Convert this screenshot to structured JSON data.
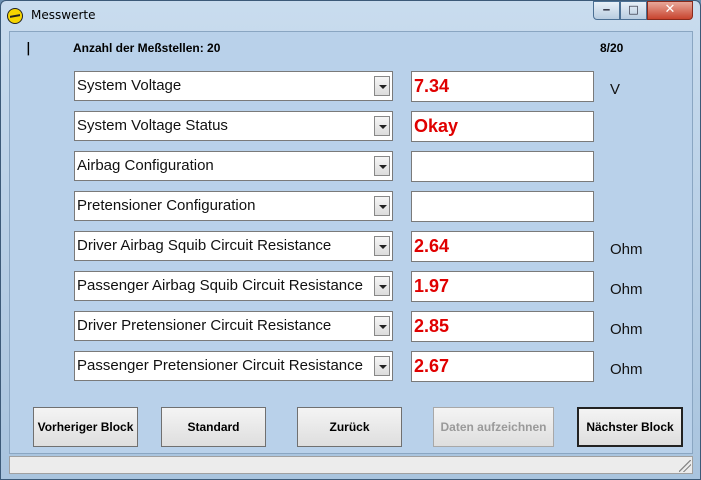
{
  "window": {
    "title": "Messwerte"
  },
  "header": {
    "mark": "|",
    "count_label": "Anzahl der Meßstellen: 20",
    "page": "8/20"
  },
  "measurements": [
    {
      "name": "System Voltage",
      "value": "7.34",
      "unit": "V"
    },
    {
      "name": "System Voltage Status",
      "value": "Okay",
      "unit": ""
    },
    {
      "name": "Airbag Configuration",
      "value": "",
      "unit": ""
    },
    {
      "name": "Pretensioner Configuration",
      "value": "",
      "unit": ""
    },
    {
      "name": "Driver Airbag Squib Circuit Resistance",
      "value": "2.64",
      "unit": "Ohm"
    },
    {
      "name": "Passenger Airbag Squib Circuit Resistance",
      "value": "1.97",
      "unit": "Ohm"
    },
    {
      "name": "Driver Pretensioner Circuit Resistance",
      "value": "2.85",
      "unit": "Ohm"
    },
    {
      "name": "Passenger Pretensioner Circuit Resistance",
      "value": "2.67",
      "unit": "Ohm"
    }
  ],
  "buttons": {
    "previous": "Vorheriger Block",
    "standard": "Standard",
    "back": "Zurück",
    "record": "Daten aufzeichnen",
    "next": "Nächster Block"
  },
  "colors": {
    "value_text": "#e00000",
    "panel_bg": "#b9d1ea"
  },
  "icons": {
    "app": "opel-logo-icon",
    "minimize": "minimize-icon",
    "maximize": "maximize-icon",
    "close": "close-icon"
  }
}
